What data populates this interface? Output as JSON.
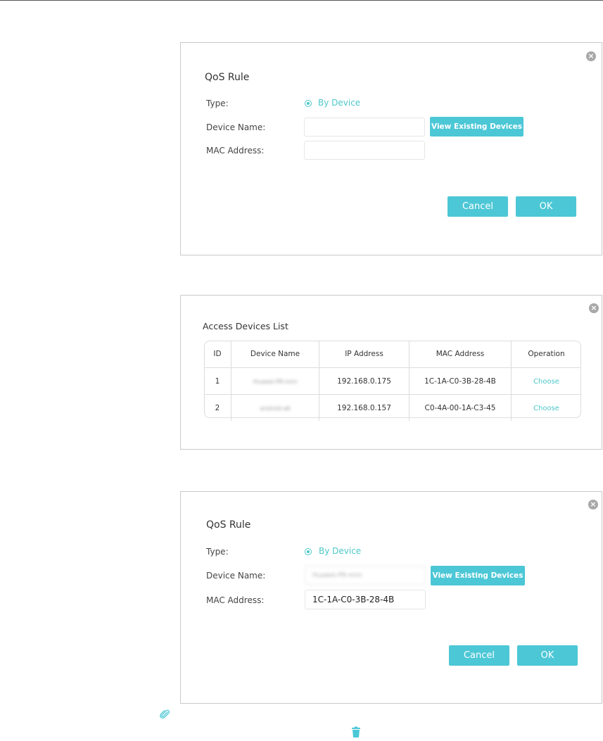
{
  "panel1": {
    "title": "QoS Rule",
    "type_label": "Type:",
    "type_option": "By Device",
    "device_name_label": "Device Name:",
    "device_name_value": "",
    "view_button": "View Existing Devices",
    "mac_label": "MAC Address:",
    "mac_value": "",
    "cancel": "Cancel",
    "ok": "OK",
    "close_glyph": "×"
  },
  "panel2": {
    "title": "Access Devices List",
    "close_glyph": "×",
    "columns": [
      "ID",
      "Device Name",
      "IP Address",
      "MAC Address",
      "Operation"
    ],
    "rows": [
      {
        "id": "1",
        "name": "Huawei-P8-mini",
        "ip": "192.168.0.175",
        "mac": "1C-1A-C0-3B-28-4B",
        "op": "Choose"
      },
      {
        "id": "2",
        "name": "android-a6",
        "ip": "192.168.0.157",
        "mac": "C0-4A-00-1A-C3-45",
        "op": "Choose"
      }
    ]
  },
  "panel3": {
    "title": "QoS Rule",
    "type_label": "Type:",
    "type_option": "By Device",
    "device_name_label": "Device Name:",
    "device_name_value": "Huawei-P8-mini",
    "view_button": "View Existing Devices",
    "mac_label": "MAC Address:",
    "mac_value": "1C-1A-C0-3B-28-4B",
    "cancel": "Cancel",
    "ok": "OK",
    "close_glyph": "×"
  },
  "icons": {
    "paperclip": "paperclip-icon",
    "trash": "trash-icon",
    "close": "close-icon"
  },
  "colors": {
    "accent": "#4cc7d6",
    "border": "#c9c9c9"
  }
}
